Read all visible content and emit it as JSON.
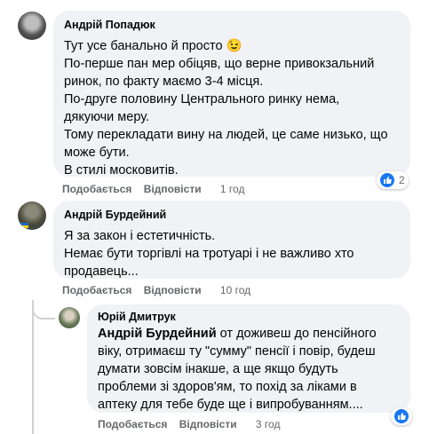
{
  "comments": [
    {
      "author": "Андрій Попадюк",
      "lines": [
        "Тут усе банально й просто 😉",
        "По-перше пан мер обіцяв, що верне привокзальний",
        "ринок, по факту маємо 3-4 місця.",
        "По-друге половину Центрального ринку нема,",
        "дякуючи меру.",
        "Тому перекладати вину на людей, це саме низько, що",
        "може бути.",
        "В стилі московитів."
      ],
      "like_label": "Подобається",
      "reply_label": "Відповісти",
      "time": "1 год",
      "reaction_icon": "like-icon",
      "reaction_count": "2"
    },
    {
      "author": "Андрій Бурдейний",
      "lines": [
        "Я за закон і естетичність.",
        "Немає бути торгівлі на тротуарі і не важливо хто",
        "продавець..."
      ],
      "like_label": "Подобається",
      "reply_label": "Відповісти",
      "time": "10 год"
    }
  ],
  "reply": {
    "author": "Юрій Дмитрук",
    "mention": "Андрій Бурдейний",
    "first_line_rest": " от доживеш до пенсійного",
    "lines": [
      "віку, отримаєш ту \"сумму\" пенсії і повір, будеш",
      "думати зовсім інакше, а ще якщо будуть",
      "проблеми зі здоров'ям, то похід за ліками в",
      "аптеку для тебе буде ще і випробуванням...."
    ],
    "like_label": "Подобається",
    "reply_label": "Відповісти",
    "time": "3 год",
    "reaction_icon": "like-icon"
  },
  "colors": {
    "bubble": "#f0f2f5",
    "meta": "#65676b",
    "like_blue": "#1877f2"
  }
}
